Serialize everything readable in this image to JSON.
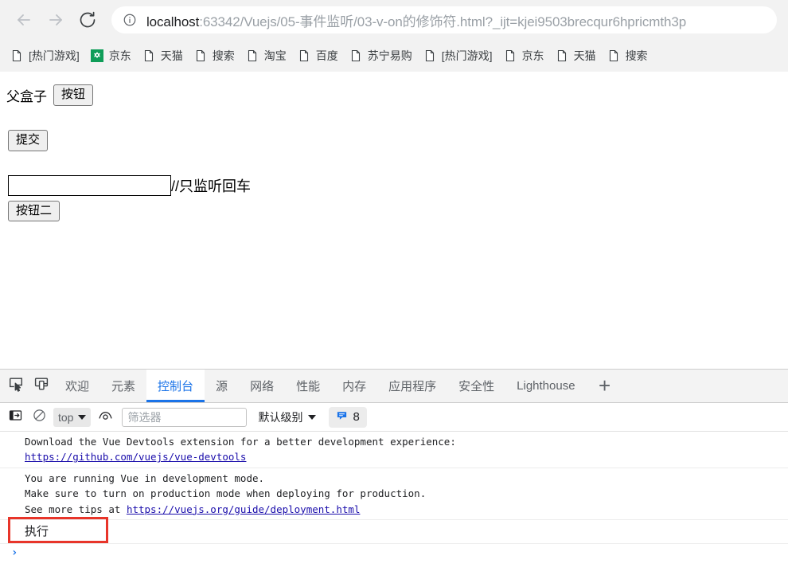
{
  "browser": {
    "nav": {
      "back_icon": "arrow-left-icon",
      "forward_icon": "arrow-right-icon",
      "reload_icon": "reload-icon"
    },
    "address_bar": {
      "info_icon": "info-circle-icon",
      "url_host": "localhost",
      "url_rest": ":63342/Vuejs/05-事件监听/03-v-on的修饰符.html?_ijt=kjei9503brecqur6hpricmth3p",
      "url_full": "localhost:63342/Vuejs/05-事件监听/03-v-on的修饰符.html?_ijt=kjei9503brecqur6hpricmth3p"
    },
    "bookmarks": [
      {
        "label": "[热门游戏]",
        "icon": "page-icon",
        "kind": "page"
      },
      {
        "label": "京东",
        "icon": "jd-favicon",
        "kind": "jd"
      },
      {
        "label": "天猫",
        "icon": "page-icon",
        "kind": "page"
      },
      {
        "label": "搜索",
        "icon": "page-icon",
        "kind": "page"
      },
      {
        "label": "淘宝",
        "icon": "page-icon",
        "kind": "page"
      },
      {
        "label": "百度",
        "icon": "page-icon",
        "kind": "page"
      },
      {
        "label": "苏宁易购",
        "icon": "page-icon",
        "kind": "page"
      },
      {
        "label": "[热门游戏]",
        "icon": "page-icon",
        "kind": "page"
      },
      {
        "label": "京东",
        "icon": "page-icon",
        "kind": "page"
      },
      {
        "label": "天猫",
        "icon": "page-icon",
        "kind": "page"
      },
      {
        "label": "搜索",
        "icon": "page-icon",
        "kind": "page"
      }
    ]
  },
  "page": {
    "parent_box_label": "父盒子",
    "button_label": "按钮",
    "submit_label": "提交",
    "input_value": "",
    "input_comment": "//只监听回车",
    "button2_label": "按钮二"
  },
  "devtools": {
    "toolbar_icons": {
      "inspect": "inspect-element-icon",
      "device": "device-toolbar-icon"
    },
    "tabs": [
      {
        "label": "欢迎",
        "active": false
      },
      {
        "label": "元素",
        "active": false
      },
      {
        "label": "控制台",
        "active": true
      },
      {
        "label": "源",
        "active": false
      },
      {
        "label": "网络",
        "active": false
      },
      {
        "label": "性能",
        "active": false
      },
      {
        "label": "内存",
        "active": false
      },
      {
        "label": "应用程序",
        "active": false
      },
      {
        "label": "安全性",
        "active": false
      },
      {
        "label": "Lighthouse",
        "active": false
      }
    ],
    "add_tab_label": "+",
    "console_toolbar": {
      "sidebar_icon": "console-sidebar-icon",
      "clear_icon": "clear-console-icon",
      "context_value": "top",
      "eye_icon": "live-expression-eye-icon",
      "filter_placeholder": "筛选器",
      "filter_value": "",
      "level_label": "默认级别",
      "message_count": "8",
      "message_icon": "speech-bubble-icon"
    },
    "console_messages": [
      {
        "id": "vue-devtools-msg",
        "text_before": "Download the Vue Devtools extension for a better development experience:\n",
        "link": "https://github.com/vuejs/vue-devtools",
        "text_after": ""
      },
      {
        "id": "vue-dev-mode-msg",
        "text_before": "You are running Vue in development mode.\nMake sure to turn on production mode when deploying for production.\nSee more tips at ",
        "link": "https://vuejs.org/guide/deployment.html",
        "text_after": ""
      },
      {
        "id": "execute-msg",
        "text_before": "执行",
        "link": "",
        "text_after": ""
      }
    ],
    "prompt_chevron": "›",
    "annotation": {
      "highlight_color": "#e8352a",
      "highlighted_text": "执行"
    }
  }
}
